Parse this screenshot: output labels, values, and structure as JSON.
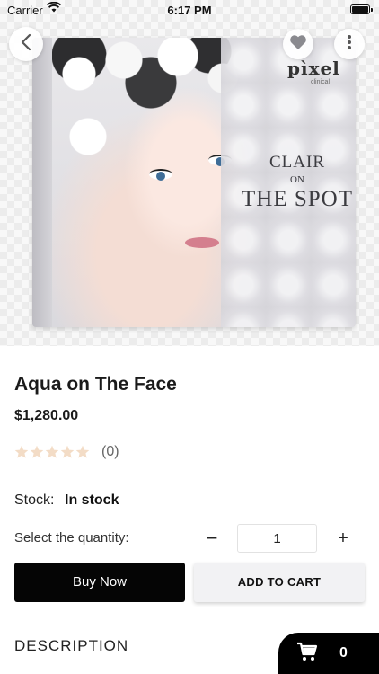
{
  "status_bar": {
    "carrier": "Carrier",
    "time": "6:17 PM"
  },
  "hero": {
    "brand": "pìxel",
    "brand_sub": "clinical",
    "box_line1": "CLAIR",
    "box_line2": "ON",
    "box_line3": "THE SPOT"
  },
  "product": {
    "name": "Aqua on The Face",
    "price": "$1,280.00",
    "rating": 0,
    "review_count": "(0)",
    "stock_label": "Stock:",
    "stock_value": "In stock"
  },
  "quantity": {
    "label": "Select the quantity:",
    "minus": "−",
    "value": "1",
    "plus": "+"
  },
  "actions": {
    "buy_now": "Buy Now",
    "add_to_cart": "ADD TO CART"
  },
  "description": {
    "heading": "DESCRIPTION"
  },
  "cart": {
    "count": "0"
  },
  "colors": {
    "star_empty": "#f3dcc6",
    "primary_button": "#050505",
    "secondary_button": "#f2f2f4"
  },
  "icons": [
    "wifi-icon",
    "battery-icon",
    "back-chevron-icon",
    "heart-icon",
    "more-vertical-icon",
    "star-icon",
    "cart-icon"
  ]
}
